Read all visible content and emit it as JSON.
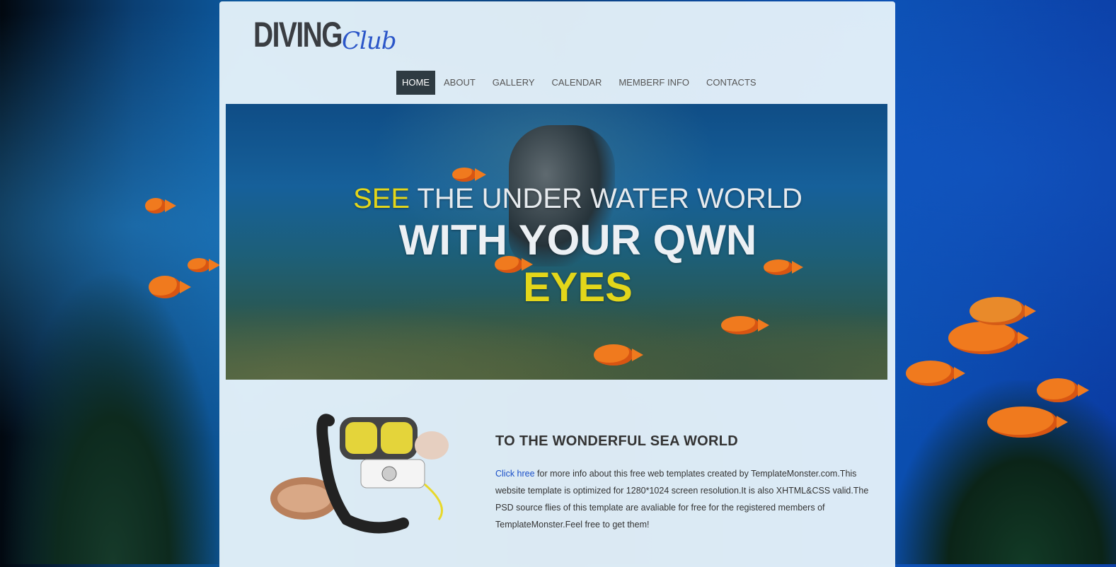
{
  "logo": {
    "main": "DIVING",
    "script": "Club"
  },
  "nav": {
    "items": [
      {
        "label": "HOME",
        "active": true
      },
      {
        "label": "ABOUT",
        "active": false
      },
      {
        "label": "GALLERY",
        "active": false
      },
      {
        "label": "CALENDAR",
        "active": false
      },
      {
        "label": "MEMBERF INFO",
        "active": false
      },
      {
        "label": "CONTACTS",
        "active": false
      }
    ]
  },
  "hero": {
    "line1_accent": "SEE",
    "line1_rest": " THE UNDER WATER WORLD",
    "line2": "WITH YOUR QWN",
    "line3": "EYES"
  },
  "content": {
    "title": "TO THE WONDERFUL SEA WORLD",
    "link_text": "Click hree",
    "body": " for more info about this free web templates created by TemplateMonster.com.This website template is optimized for 1280*1024 screen resolution.It is also XHTML&CSS valid.The PSD source flies of this template are avaliable for free for the registered members of TemplateMonster.Feel free to get them!"
  },
  "colors": {
    "accent_yellow": "#e3d61a",
    "nav_active_bg": "#2f3b42",
    "link_blue": "#1a4fc8",
    "logo_script": "#2a55c8"
  }
}
